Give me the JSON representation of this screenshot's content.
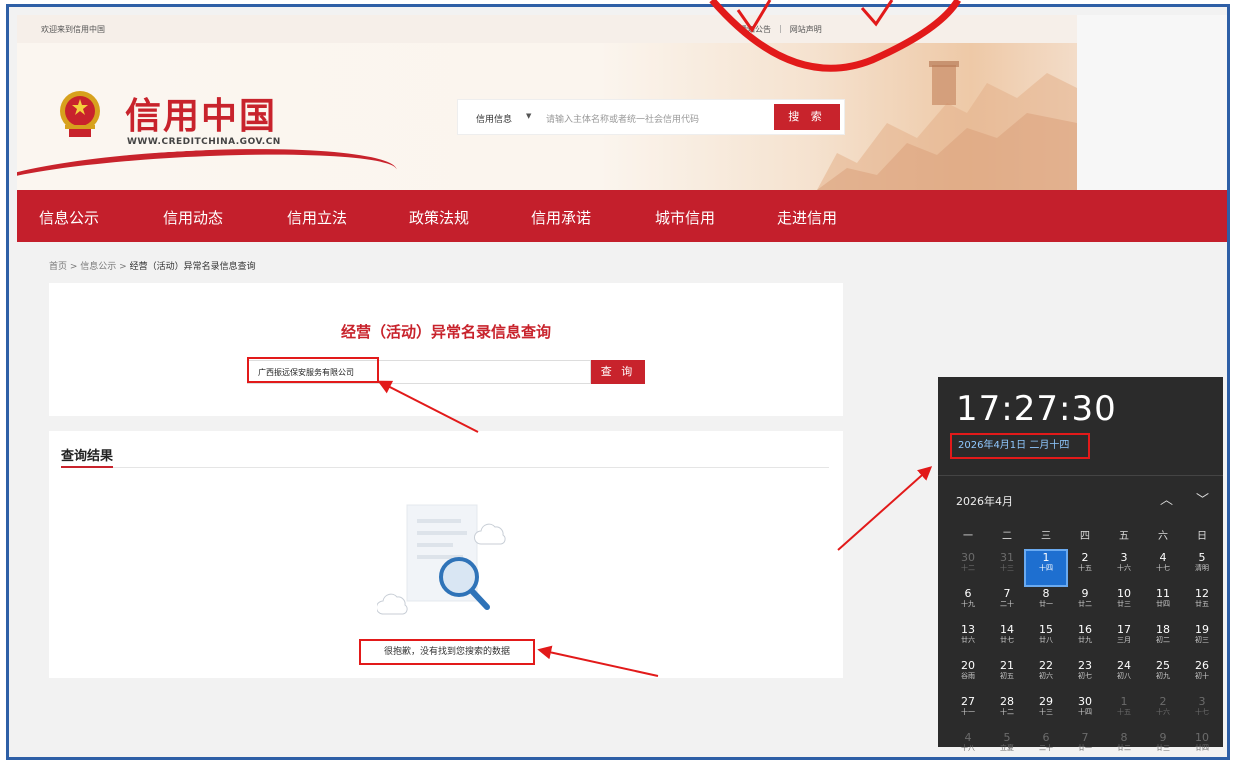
{
  "topbar": {
    "welcome": "欢迎来到信用中国",
    "notice": "通知公告",
    "separator": "|",
    "statement": "网站声明"
  },
  "header": {
    "logo_text": "信用中国",
    "logo_url": "WWW.CREDITCHINA.GOV.CN",
    "search_type": "信用信息",
    "search_placeholder": "请输入主体名称或者统一社会信用代码",
    "search_button": "搜 索"
  },
  "nav": {
    "items": [
      "信息公示",
      "信用动态",
      "信用立法",
      "政策法规",
      "信用承诺",
      "城市信用",
      "走进信用"
    ]
  },
  "breadcrumb": {
    "home": "首页",
    "sep1": " > ",
    "section": "信息公示",
    "sep2": " > ",
    "current": "经营（活动）异常名录信息查询"
  },
  "query": {
    "title": "经营（活动）异常名录信息查询",
    "input_value": "广西振远保安服务有限公司",
    "button": "查 询"
  },
  "results": {
    "heading": "查询结果",
    "empty_message": "很抱歉，没有找到您搜索的数据"
  },
  "clock": {
    "time": "17:27:30",
    "date": "2026年4月1日 二月十四",
    "month_label": "2026年4月",
    "up_icon": "chevron-up-icon",
    "down_icon": "chevron-down-icon",
    "weekdays": [
      "一",
      "二",
      "三",
      "四",
      "五",
      "六",
      "日"
    ],
    "weeks": [
      [
        {
          "n": "30",
          "l": "十二",
          "dim": true
        },
        {
          "n": "31",
          "l": "十三",
          "dim": true
        },
        {
          "n": "1",
          "l": "十四",
          "today": true
        },
        {
          "n": "2",
          "l": "十五"
        },
        {
          "n": "3",
          "l": "十六"
        },
        {
          "n": "4",
          "l": "十七"
        },
        {
          "n": "5",
          "l": "清明"
        }
      ],
      [
        {
          "n": "6",
          "l": "十九"
        },
        {
          "n": "7",
          "l": "二十"
        },
        {
          "n": "8",
          "l": "廿一"
        },
        {
          "n": "9",
          "l": "廿二"
        },
        {
          "n": "10",
          "l": "廿三"
        },
        {
          "n": "11",
          "l": "廿四"
        },
        {
          "n": "12",
          "l": "廿五"
        }
      ],
      [
        {
          "n": "13",
          "l": "廿六"
        },
        {
          "n": "14",
          "l": "廿七"
        },
        {
          "n": "15",
          "l": "廿八"
        },
        {
          "n": "16",
          "l": "廿九"
        },
        {
          "n": "17",
          "l": "三月"
        },
        {
          "n": "18",
          "l": "初二"
        },
        {
          "n": "19",
          "l": "初三"
        }
      ],
      [
        {
          "n": "20",
          "l": "谷雨"
        },
        {
          "n": "21",
          "l": "初五"
        },
        {
          "n": "22",
          "l": "初六"
        },
        {
          "n": "23",
          "l": "初七"
        },
        {
          "n": "24",
          "l": "初八"
        },
        {
          "n": "25",
          "l": "初九"
        },
        {
          "n": "26",
          "l": "初十"
        }
      ],
      [
        {
          "n": "27",
          "l": "十一"
        },
        {
          "n": "28",
          "l": "十二"
        },
        {
          "n": "29",
          "l": "十三"
        },
        {
          "n": "30",
          "l": "十四"
        },
        {
          "n": "1",
          "l": "十五",
          "dim": true
        },
        {
          "n": "2",
          "l": "十六",
          "dim": true
        },
        {
          "n": "3",
          "l": "十七",
          "dim": true
        }
      ],
      [
        {
          "n": "4",
          "l": "十八",
          "dim": true
        },
        {
          "n": "5",
          "l": "立夏",
          "dim": true
        },
        {
          "n": "6",
          "l": "二十",
          "dim": true
        },
        {
          "n": "7",
          "l": "廿一",
          "dim": true
        },
        {
          "n": "8",
          "l": "廿二",
          "dim": true
        },
        {
          "n": "9",
          "l": "廿三",
          "dim": true
        },
        {
          "n": "10",
          "l": "廿四",
          "dim": true
        }
      ]
    ]
  },
  "colors": {
    "brand_red": "#c8232c",
    "annotation_red": "#e21a1a",
    "frame_blue": "#2e5fa6",
    "clock_bg": "#2b2b2b",
    "today_blue": "#1e6fd0"
  }
}
